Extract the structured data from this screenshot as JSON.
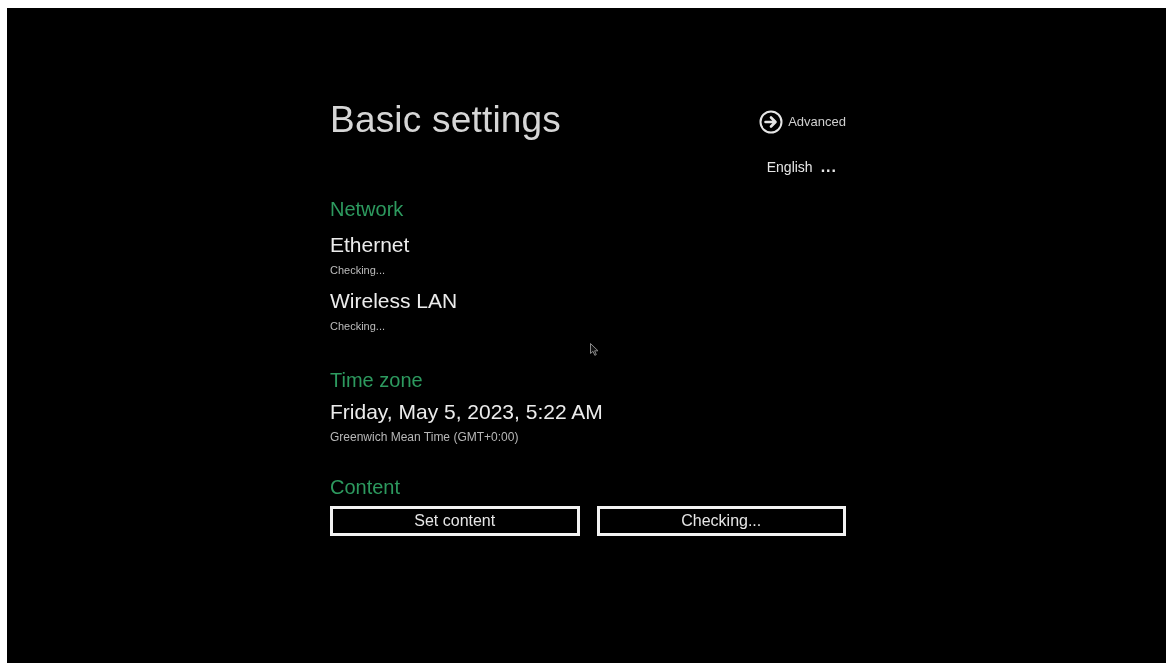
{
  "header": {
    "title": "Basic settings",
    "advanced_link": "Advanced",
    "language": "English",
    "language_more": "..."
  },
  "network": {
    "heading": "Network",
    "items": [
      {
        "name": "Ethernet",
        "status": "Checking..."
      },
      {
        "name": "Wireless LAN",
        "status": "Checking..."
      }
    ]
  },
  "time_zone": {
    "heading": "Time zone",
    "value": "Friday, May 5, 2023, 5:22 AM",
    "zone": "Greenwich Mean Time (GMT+0:00)"
  },
  "content": {
    "heading": "Content",
    "buttons": [
      "Set content",
      "Checking..."
    ]
  }
}
